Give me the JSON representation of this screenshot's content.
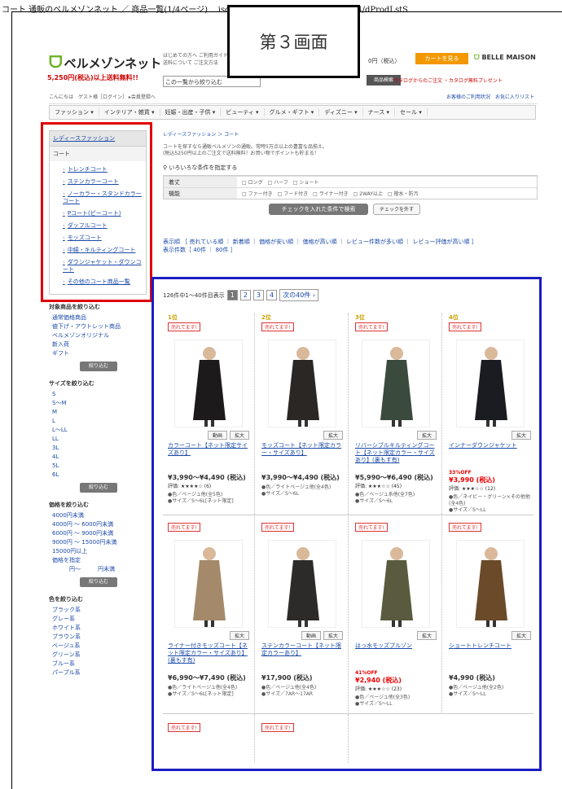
{
  "window": {
    "title": "コート 通販のベルメゾンネット ／ 商品一覧(1/4ページ) ...ison.jp/ep/srvlt/EPFB00/EPFB0004/dProdLstS"
  },
  "callout": "第３画面",
  "header": {
    "logo": "ベルメゾンネット",
    "free_shipping": "5,250円(税込)以上送料無料!!",
    "links": [
      "はじめての方へ ご利用ガイド",
      "送料について ご注文方法"
    ],
    "search_placeholder": "この一覧から絞り込む",
    "search_btn": "商品検索",
    "tel": "0円（税込）",
    "cart": "カートを見る",
    "brand": "BELLE MAISON",
    "catalog_links": "カタログからのご注文 ・カタログ無料プレゼント",
    "greeting": "こんにちは　ゲスト様［ログイン］ ▸会員登録へ",
    "top_right": "お客様のご利用状況　お気に入りリスト"
  },
  "catnav": [
    "ファッション ▾",
    "インテリア・雑貨 ▾",
    "妊娠・出産・子供 ▾",
    "ビューティ ▾",
    "グルメ・ギフト ▾",
    "ディズニー ▾",
    "ナース ▾",
    "セール ▾"
  ],
  "sidebar": {
    "heading": "レディースファッション",
    "sub": "コート",
    "items": [
      "トレンチコート",
      "ステンカラーコート",
      "ノーカラー・スタンドカラーコート",
      "Pコート(ピーコート)",
      "ダッフルコート",
      "モッズコート",
      "中綿・キルティングコート",
      "ダウンジャケット・ダウンコート",
      "その他のコート商品一覧"
    ]
  },
  "filters": [
    {
      "heading": "対象商品を絞り込む",
      "items": [
        "通常価格商品",
        "値下げ・アウトレット商品",
        "ベルメゾンオリジナル",
        "新入荷",
        "ギフト"
      ]
    },
    {
      "heading": "サイズを絞り込む",
      "items": [
        "S",
        "S〜M",
        "M",
        "L",
        "L〜LL",
        "LL",
        "3L",
        "4L",
        "5L",
        "6L"
      ]
    },
    {
      "heading": "価格を絞り込む",
      "items": [
        "4000円未満",
        "4000円 〜 6000円未満",
        "6000円 〜 9000円未満",
        "9000円 〜 15000円未満",
        "15000円以上",
        "価格を指定",
        "　　　円〜　　　円未満"
      ]
    },
    {
      "heading": "色を絞り込む",
      "items": [
        "ブラック系",
        "グレー系",
        "ホワイト系",
        "ブラウン系",
        "ベージュ系",
        "グリーン系",
        "ブルー系",
        "パープル系"
      ]
    }
  ],
  "filter_btn": "絞り込む",
  "main": {
    "breadcrumb": "レディースファッション ＞ コート",
    "intro": "コートを探すなら通販ベルメゾンの通販。常時5万点以上の豊富な品揃え。\n(税込5250円以上のご注文で送料無料！お買い物でポイントも貯まる！",
    "cond_title": "いろいろな条件を指定する",
    "cond_rows": [
      {
        "label": "着丈",
        "opts": "□ ロング　□ ハーフ　□ ショート"
      },
      {
        "label": "機能",
        "opts": "□ ファー付き　□ フード付き　□ ライナー付き　□ 2WAY以上　□ 撥水・防汚"
      }
    ],
    "check_btn": "チェックを入れた条件で検索",
    "clear_btn": "チェックを外す",
    "sort": "表示順 ［ 売れている順 ｜ 新着順 ｜ 価格が安い順 ｜ 価格が高い順 ｜ レビュー件数が多い順 ｜ レビュー評価が高い順 ］",
    "count": "表示件数［ 40件 ｜ 80件 ］",
    "result": "126件中1〜40件目表示",
    "pages": [
      "1",
      "2",
      "3",
      "4"
    ],
    "next": "次の40件 ›"
  },
  "products": [
    {
      "rank": "1位",
      "sell": "売れてます!",
      "name": "カラーコート【ネット限定サイズあり】",
      "price": "¥3,990〜¥4,490 (税込)",
      "off": "",
      "review": "評価: ★★★★☆ (6)",
      "detail": "●色／ベージュ他(全5色)\n●サイズ／S〜6L[ネット限定]",
      "video": true
    },
    {
      "rank": "2位",
      "sell": "売れてます!",
      "name": "モッズコート【ネット限定カラー・サイズあり】",
      "price": "¥3,990〜¥4,490 (税込)",
      "off": "",
      "review": "",
      "detail": "●色／ライトベージュ他(全4色)\n●サイズ／S〜6L",
      "video": false
    },
    {
      "rank": "3位",
      "sell": "売れてます!",
      "name": "リバーシブルキルティングコート【ネット限定カラー・サイズあり】(裏もす有)",
      "price": "¥5,990〜¥6,490 (税込)",
      "off": "",
      "review": "評価: ★★★☆☆ (45)",
      "detail": "●色／ベージュ系他(全7色)\n●サイズ／S〜6L",
      "video": false
    },
    {
      "rank": "4位",
      "sell": "売れてます!",
      "name": "インナーダウンジャケット",
      "price": "¥3,990 (税込)",
      "off": "33%OFF",
      "review": "評価: ★★★☆☆ (12)",
      "detail": "●色／ネイビー・グリーン×その他他(全4色)\n●サイズ／S〜LL",
      "video": false
    },
    {
      "rank": "",
      "sell": "売れてます!",
      "name": "ライナー付きモッズコート【ネット限定カラー・サイズあり】(裏もす有)",
      "price": "¥6,990〜¥7,490 (税込)",
      "off": "",
      "review": "",
      "detail": "●色／ライトベージュ他(全4色)\n●サイズ／S〜6L[ネット限定]",
      "video": false
    },
    {
      "rank": "",
      "sell": "売れてます!",
      "name": "ステンカラーコート【ネット限定カラーあり】",
      "price": "¥17,900 (税込)",
      "off": "",
      "review": "",
      "detail": "●色／ベージュ他(全4色)\n●サイズ／7AR〜17AR",
      "video": true
    },
    {
      "rank": "",
      "sell": "売れてます!",
      "name": "はっ水モッズブルゾン",
      "price": "¥2,940 (税込)",
      "off": "41%OFF",
      "review": "評価: ★★★☆☆ (23)",
      "detail": "●色／ベージュ他(全3色)\n●サイズ／S〜LL",
      "video": false
    },
    {
      "rank": "",
      "sell": "売れてます!",
      "name": "ショートトレンチコート",
      "price": "¥4,990 (税込)",
      "off": "",
      "review": "",
      "detail": "●色／ベージュ他(全2色)\n●サイズ／S〜LL",
      "video": false
    },
    {
      "rank": "",
      "sell": "売れてます!",
      "name": "",
      "price": "",
      "off": "",
      "review": "",
      "detail": "",
      "video": false
    },
    {
      "rank": "",
      "sell": "売れてます!",
      "name": "",
      "price": "",
      "off": "",
      "review": "",
      "detail": "",
      "video": false
    }
  ],
  "labels": {
    "zoom": "拡大",
    "video": "動画"
  },
  "colors": {
    "coat": [
      "#1c1a1a",
      "#2a2725",
      "#3a4a3c",
      "#1b1c22",
      "#a48a6a",
      "#2c2b2a",
      "#5a5a3e",
      "#6b4a2a"
    ]
  }
}
